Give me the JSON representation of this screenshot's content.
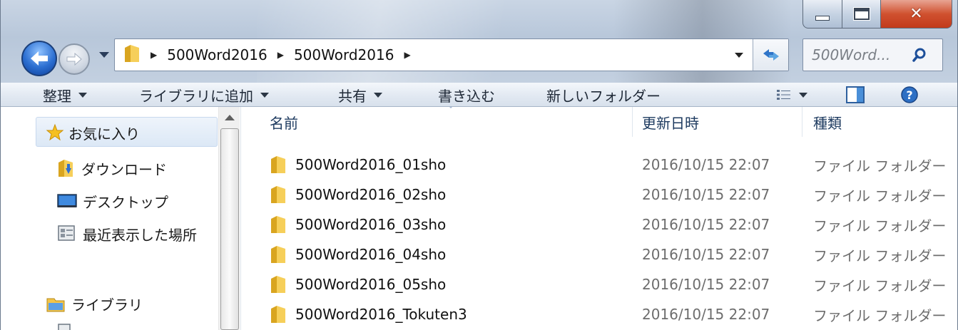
{
  "window": {
    "caption_buttons": {
      "minimize": "minimize",
      "maximize": "maximize",
      "close": "close"
    }
  },
  "address_bar": {
    "crumbs": [
      "500Word2016",
      "500Word2016"
    ]
  },
  "search": {
    "placeholder": "500Word..."
  },
  "command_bar": {
    "organize": "整理",
    "add_to_library": "ライブラリに追加",
    "share": "共有",
    "burn": "書き込む",
    "new_folder": "新しいフォルダー"
  },
  "nav_pane": {
    "favorites": "お気に入り",
    "downloads": "ダウンロード",
    "desktop": "デスクトップ",
    "recent_places": "最近表示した場所",
    "libraries": "ライブラリ"
  },
  "file_list": {
    "columns": {
      "name": "名前",
      "date": "更新日時",
      "type": "種類"
    },
    "rows": [
      {
        "name": "500Word2016_01sho",
        "date": "2016/10/15 22:07",
        "type": "ファイル フォルダー"
      },
      {
        "name": "500Word2016_02sho",
        "date": "2016/10/15 22:07",
        "type": "ファイル フォルダー"
      },
      {
        "name": "500Word2016_03sho",
        "date": "2016/10/15 22:07",
        "type": "ファイル フォルダー"
      },
      {
        "name": "500Word2016_04sho",
        "date": "2016/10/15 22:07",
        "type": "ファイル フォルダー"
      },
      {
        "name": "500Word2016_05sho",
        "date": "2016/10/15 22:07",
        "type": "ファイル フォルダー"
      },
      {
        "name": "500Word2016_Tokuten3",
        "date": "2016/10/15 22:07",
        "type": "ファイル フォルダー"
      }
    ]
  },
  "colors": {
    "accent": "#2c6fd1",
    "close_red": "#c23a1b",
    "folder_yellow": "#f2c14e",
    "secondary_text": "#6d6d6d"
  }
}
